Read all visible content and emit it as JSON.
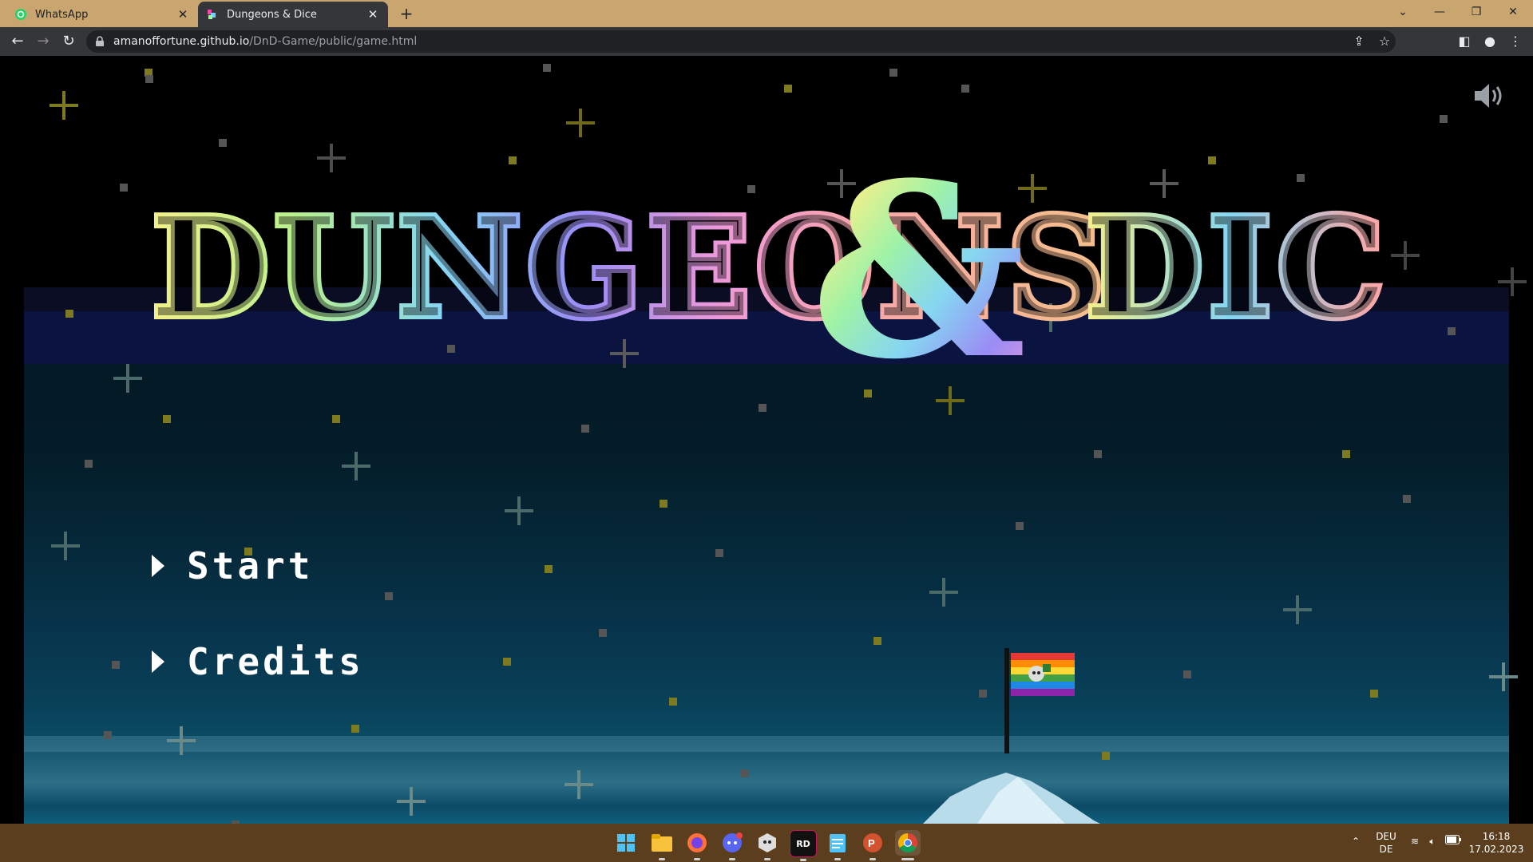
{
  "browser": {
    "tabs": [
      {
        "title": "WhatsApp",
        "active": false,
        "icon": "whatsapp-icon"
      },
      {
        "title": "Dungeons & Dice",
        "active": true,
        "icon": "dnd-icon"
      }
    ],
    "new_tab_label": "+",
    "url_host": "amanoffortune.github.io",
    "url_path": "/DnD-Game/public/game.html",
    "window_controls": [
      "chevron-down-icon",
      "minimize-icon",
      "restore-icon",
      "close-icon"
    ]
  },
  "game": {
    "logo": {
      "word1": "DUNGEONS",
      "ampersand": "&",
      "word2": "DICE"
    },
    "menu": [
      {
        "label": "Start"
      },
      {
        "label": "Credits"
      }
    ],
    "sound_icon": "speaker-on-icon",
    "colors": {
      "background": "#000000",
      "menu_text": "#ffffff",
      "sea_light": "#2e6f88"
    }
  },
  "taskbar": {
    "apps": [
      "windows-start-icon",
      "file-explorer-icon",
      "firefox-icon",
      "discord-icon",
      "hacker-app-icon",
      "rider-icon",
      "notepad-icon",
      "powerpoint-icon",
      "chrome-icon"
    ],
    "tray": {
      "language_top": "DEU",
      "language_bottom": "DE",
      "time": "16:18",
      "date": "17.02.2023"
    }
  }
}
